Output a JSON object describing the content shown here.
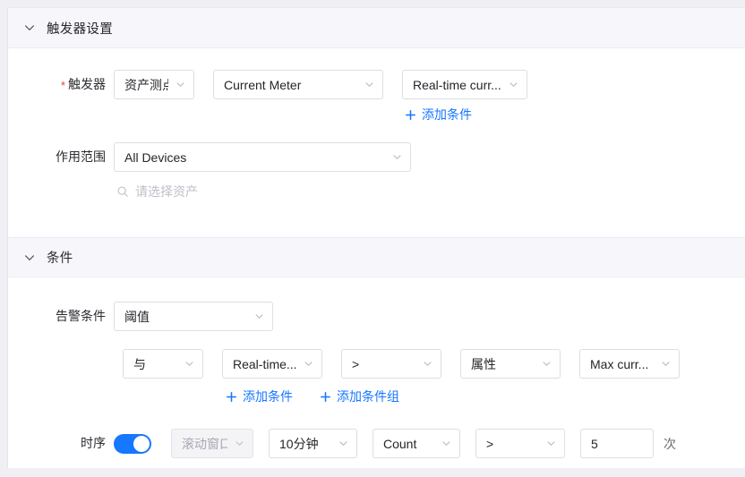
{
  "sections": [
    {
      "id": "trigger",
      "title": "触发器设置",
      "chevron_icon": "chevron-down-icon"
    },
    {
      "id": "condition",
      "title": "条件",
      "chevron_icon": "chevron-down-icon"
    }
  ],
  "trigger": {
    "label": "触发器",
    "required_mark": "*",
    "source_type": "资产测点",
    "asset": "Current Meter",
    "metric": "Real-time curr...",
    "add_condition": {
      "label": "添加条件",
      "icon": "plus-icon"
    }
  },
  "scope": {
    "label": "作用范围",
    "value": "All Devices",
    "search_placeholder": "请选择资产",
    "search_icon": "search-icon"
  },
  "condition": {
    "alarm_label": "告警条件",
    "alarm_type": "阈值",
    "rule": {
      "logic": "与",
      "metric": "Real-time...",
      "operator": ">",
      "target_type": "属性",
      "target_value": "Max curr..."
    },
    "add_condition": {
      "label": "添加条件",
      "icon": "plus-icon"
    },
    "add_condition_group": {
      "label": "添加条件组",
      "icon": "plus-icon"
    },
    "timing": {
      "label": "时序",
      "enabled": true,
      "window_type": "滚动窗口",
      "window_size": "10分钟",
      "aggregation": "Count",
      "operator": ">",
      "threshold": "5",
      "unit": "次"
    }
  },
  "colors": {
    "accent": "#1677ff",
    "required": "#e8413c",
    "section_band": "#f7f7fb",
    "border": "#dedee4"
  }
}
